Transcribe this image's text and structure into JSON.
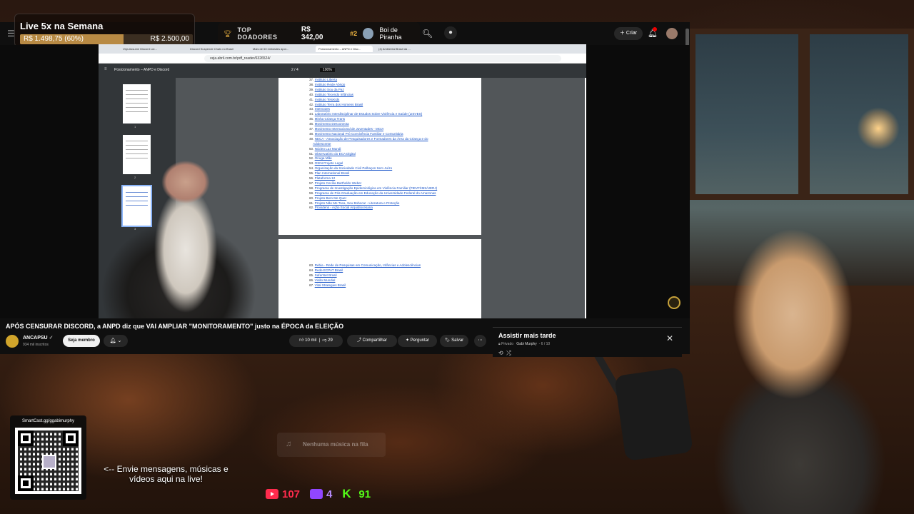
{
  "goal": {
    "title": "Live 5x na Semana",
    "current": "R$ 1.498,75 (60%)",
    "target": "R$ 2.500,00",
    "progress": 0.6
  },
  "donors": {
    "label": "TOP DOADORES",
    "top_amount": "R$ 342,00",
    "rank": "#2",
    "name": "Boi de Piranha"
  },
  "yt": {
    "create_label": "Criar",
    "title": "APÓS CENSURAR DISCORD, a ANPD diz que VAI AMPLIAR \"MONITORAMENTO\" justo na ÉPOCA da ELEIÇÃO",
    "channel": "ANCAPSU",
    "subscribers": "934 mil inscritos",
    "member_label": "Seja membro",
    "likes": "10 mil",
    "dislikes": "29",
    "share": "Compartilhar",
    "ask": "Perguntar",
    "save": "Salvar"
  },
  "watch_later": {
    "title": "Assistir mais tarde",
    "privacy": "Privado",
    "owner": "Gabi Murphy",
    "position": "6 / 10"
  },
  "browser": {
    "tabs": [
      "Veja Assume Discord Lut...",
      "Discord Suspende Chats no Brasil",
      "Mais de 60 entidades apoi...",
      "Posicionamento – ANPD e Disc...",
      "(4) Ambiental Brasil da ..."
    ],
    "url": "veja.abril.com.br/pdf_reader/6326524/",
    "pdf_title": "Posicionamento – ANPD e Discord",
    "pdf_page": "2 / 4",
    "pdf_zoom": "100%",
    "page1_entries": [
      {
        "n": "37.",
        "t": "Instituto Liberta"
      },
      {
        "n": "38.",
        "t": "Instituto Rede Abrigo"
      },
      {
        "n": "39.",
        "t": "Instituto Sou da Paz"
      },
      {
        "n": "40.",
        "t": "Instituto Tecendo Infâncias"
      },
      {
        "n": "41.",
        "t": "Instituto TeloKids"
      },
      {
        "n": "42.",
        "t": "Instituto Terra dos Homens Brasil"
      },
      {
        "n": "43.",
        "t": "Intervozes"
      },
      {
        "n": "44.",
        "t": "Laboratório Interdisciplinar de Estudos Sobre Violência e Saúde (LIEVES)"
      },
      {
        "n": "45.",
        "t": "Minha Criança Trans"
      },
      {
        "n": "46.",
        "t": "Movimento Desconecta"
      },
      {
        "n": "47.",
        "t": "Movimento Internacional de Juventudes - MOJI"
      },
      {
        "n": "48.",
        "t": "Movimento Nacional Pró Convivência Familiar e Comunitária"
      },
      {
        "n": "49.",
        "t": "NECA - Associação de Pesquisadores e Formadores da Área da Criança e do"
      },
      {
        "n": "",
        "t": "Adolescente"
      },
      {
        "n": "50.",
        "t": "Núcleo Luz Mundi"
      },
      {
        "n": "51.",
        "t": "Observatório do ECA Digital"
      },
      {
        "n": "52.",
        "t": "Onuga Mãe"
      },
      {
        "n": "53.",
        "t": "OSIN Projeto Legal"
      },
      {
        "n": "54.",
        "t": "Organização da Sociedade Civil Palhaços Sem Juízo"
      },
      {
        "n": "55.",
        "t": "Plan International Brasil"
      },
      {
        "n": "56.",
        "t": "Plataforma 12"
      },
      {
        "n": "57.",
        "t": "Projeto Cecília Bartholdo Weber"
      },
      {
        "n": "58.",
        "t": "Programa de Investigação Epidemiológica em Violência Familiar (PIEVF/IMS/UERJ)"
      },
      {
        "n": "59.",
        "t": "Programa de Pós-Graduação em Educação da Universidade Federal do Amazonas"
      },
      {
        "n": "60.",
        "t": "Projeto Bem Me Quer"
      },
      {
        "n": "61.",
        "t": "Projeto Não Me Toca, Seu Boboca! - Literatura e Proteção"
      },
      {
        "n": "62.",
        "t": "Providens - Ação Social Arquidiocesana"
      }
    ],
    "page2_entries": [
      {
        "n": "63.",
        "t": "Rebia - Rede de Pesquisas em Comunicação, Infâncias e Adolescências"
      },
      {
        "n": "64.",
        "t": "Rede ECPAT Brasil"
      },
      {
        "n": "65.",
        "t": "SaferNet Brasil"
      },
      {
        "n": "66.",
        "t": "Visão Mundial"
      },
      {
        "n": "67.",
        "t": "Vital Strategies Brasil"
      }
    ],
    "thumb_numbers": [
      "1",
      "2",
      "3"
    ]
  },
  "overlay": {
    "qr_url": "SmartCast.gg/ggabimurphy",
    "message": "<-- Envie mensagens, músicas e vídeos aqui na live!",
    "music_empty": "Nenhuma música na fila"
  },
  "viewers": {
    "youtube": "107",
    "twitch": "4",
    "kick": "91"
  },
  "colors": {
    "accent_gold": "#b88a44",
    "youtube": "#ff2b4d",
    "twitch": "#9146ff",
    "kick": "#53fc18"
  }
}
